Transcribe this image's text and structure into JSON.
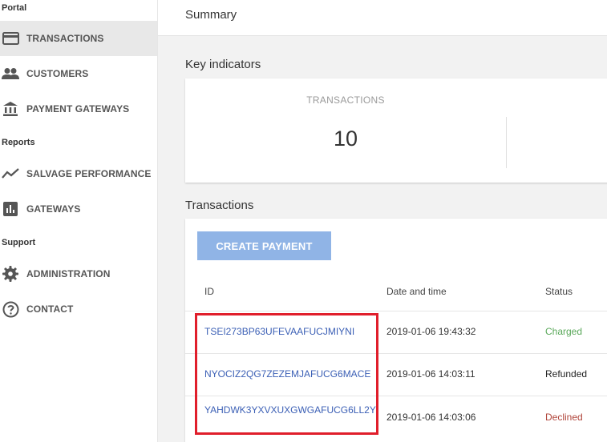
{
  "sidebar": {
    "sections": [
      {
        "label": "Portal"
      },
      {
        "label": "Reports"
      },
      {
        "label": "Support"
      }
    ],
    "items": [
      {
        "label": "TRANSACTIONS",
        "icon": "credit-card-icon"
      },
      {
        "label": "CUSTOMERS",
        "icon": "people-icon"
      },
      {
        "label": "PAYMENT GATEWAYS",
        "icon": "bank-icon"
      },
      {
        "label": "SALVAGE PERFORMANCE",
        "icon": "trend-line-icon"
      },
      {
        "label": "GATEWAYS",
        "icon": "bar-chart-icon"
      },
      {
        "label": "ADMINISTRATION",
        "icon": "gear-icon"
      },
      {
        "label": "CONTACT",
        "icon": "help-icon"
      }
    ]
  },
  "header": {
    "title": "Summary"
  },
  "key_indicators": {
    "title": "Key indicators",
    "label": "TRANSACTIONS",
    "value": "10"
  },
  "transactions": {
    "title": "Transactions",
    "create_button": "CREATE PAYMENT",
    "columns": [
      "ID",
      "Date and time",
      "Status"
    ],
    "rows": [
      {
        "id": "TSEI273BP63UFEVAAFUCJMIYNI",
        "datetime": "2019-01-06 19:43:32",
        "status": "Charged"
      },
      {
        "id": "NYOCIZ2QG7ZEZEMJAFUCG6MACE",
        "datetime": "2019-01-06 14:03:11",
        "status": "Refunded"
      },
      {
        "id": "YAHDWK3YXVXUXGWGAFUCG6LL2Y",
        "datetime": "2019-01-06 14:03:06",
        "status": "Declined"
      }
    ]
  },
  "colors": {
    "accent_button": "#90b4e6",
    "link": "#3b5fb5",
    "status_charged": "#5aa85a",
    "status_refunded": "#222222",
    "status_declined": "#b0443a",
    "highlight": "#e01e2b"
  }
}
